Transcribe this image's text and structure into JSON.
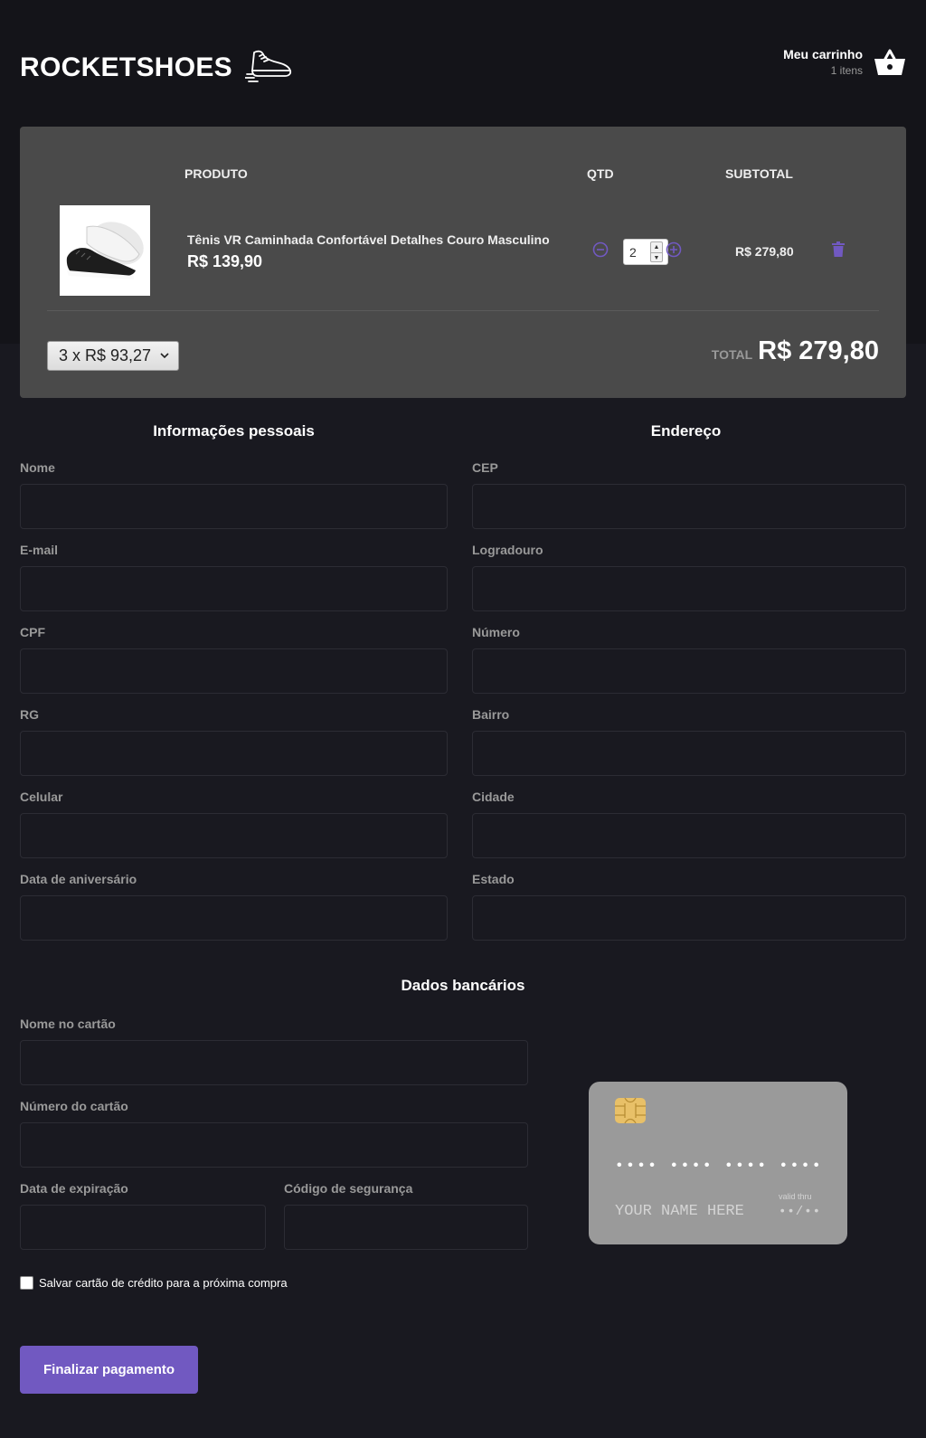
{
  "header": {
    "logo_text": "ROCKETSHOES",
    "cart_title": "Meu carrinho",
    "cart_count": "1 itens"
  },
  "cart": {
    "columns": {
      "product": "PRODUTO",
      "qty": "QTD",
      "subtotal": "SUBTOTAL"
    },
    "item": {
      "title": "Tênis VR Caminhada Confortável Detalhes Couro Masculino",
      "price": "R$ 139,90",
      "quantity": "2",
      "subtotal": "R$ 279,80"
    },
    "installments_selected": "3 x R$ 93,27",
    "total_label": "TOTAL",
    "total_value": "R$ 279,80"
  },
  "personal": {
    "title": "Informações pessoais",
    "fields": [
      "Nome",
      "E-mail",
      "CPF",
      "RG",
      "Celular",
      "Data de aniversário"
    ]
  },
  "address": {
    "title": "Endereço",
    "fields": [
      "CEP",
      "Logradouro",
      "Número",
      "Bairro",
      "Cidade",
      "Estado"
    ]
  },
  "bank": {
    "title": "Dados bancários",
    "card_name_label": "Nome no cartão",
    "card_number_label": "Número do cartão",
    "expiration_label": "Data de expiração",
    "security_code_label": "Código de segurança",
    "save_card_label": "Salvar cartão de crédito para a próxima compra",
    "submit_label": "Finalizar pagamento"
  },
  "card_preview": {
    "number": "•••• •••• •••• ••••",
    "name": "YOUR NAME HERE",
    "valid_thru_label": "valid thru",
    "expiration": "••/••"
  },
  "colors": {
    "accent": "#7159c1",
    "background": "#191920",
    "cart_panel": "#4a4a4a",
    "card_preview": "#9a9a9a"
  },
  "icons": {
    "logo": "sneaker-icon",
    "cart": "shopping-basket-icon",
    "decrement": "minus-circle-icon",
    "increment": "plus-circle-icon",
    "delete": "trash-icon",
    "chip": "card-chip-icon"
  }
}
